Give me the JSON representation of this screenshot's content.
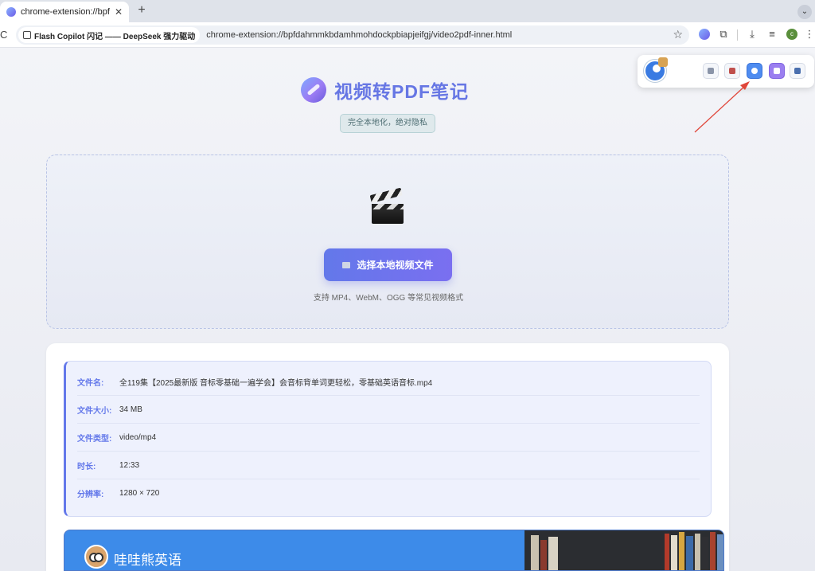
{
  "browser": {
    "tab_title": "chrome-extension://bpfdahmm",
    "tab_close": "✕",
    "new_tab": "+",
    "tab_menu": "⌄",
    "reload": "C",
    "site_chip": "Flash Copilot 闪记 —— DeepSeek 强力驱动",
    "url": "chrome-extension://bpfdahmmkbdamhmohdockpbiapjeifgj/video2pdf-inner.html",
    "star": "☆",
    "avatar_letter": "c",
    "icons": {
      "puzzle": "⧉",
      "download": "⤓",
      "media": "≡",
      "menu": "⋮"
    }
  },
  "header": {
    "title": "视频转PDF笔记",
    "badge": "完全本地化，绝对隐私"
  },
  "upload": {
    "button_label": "选择本地视频文件",
    "formats_hint": "支持 MP4、WebM、OGG 等常见视频格式"
  },
  "file_info": [
    {
      "label": "文件名:",
      "value": "全119集【2025最新版 音标零基础一遍学会】会音标背单词更轻松，零基础英语音标.mp4"
    },
    {
      "label": "文件大小:",
      "value": "34 MB"
    },
    {
      "label": "文件类型:",
      "value": "video/mp4"
    },
    {
      "label": "时长:",
      "value": "12:33"
    },
    {
      "label": "分辨率:",
      "value": "1280 × 720"
    }
  ],
  "video_banner": {
    "text": "哇哇熊英语"
  },
  "colors": {
    "accent": "#6378ea",
    "banner": "#3d8be9",
    "arrow": "#e0463a"
  }
}
